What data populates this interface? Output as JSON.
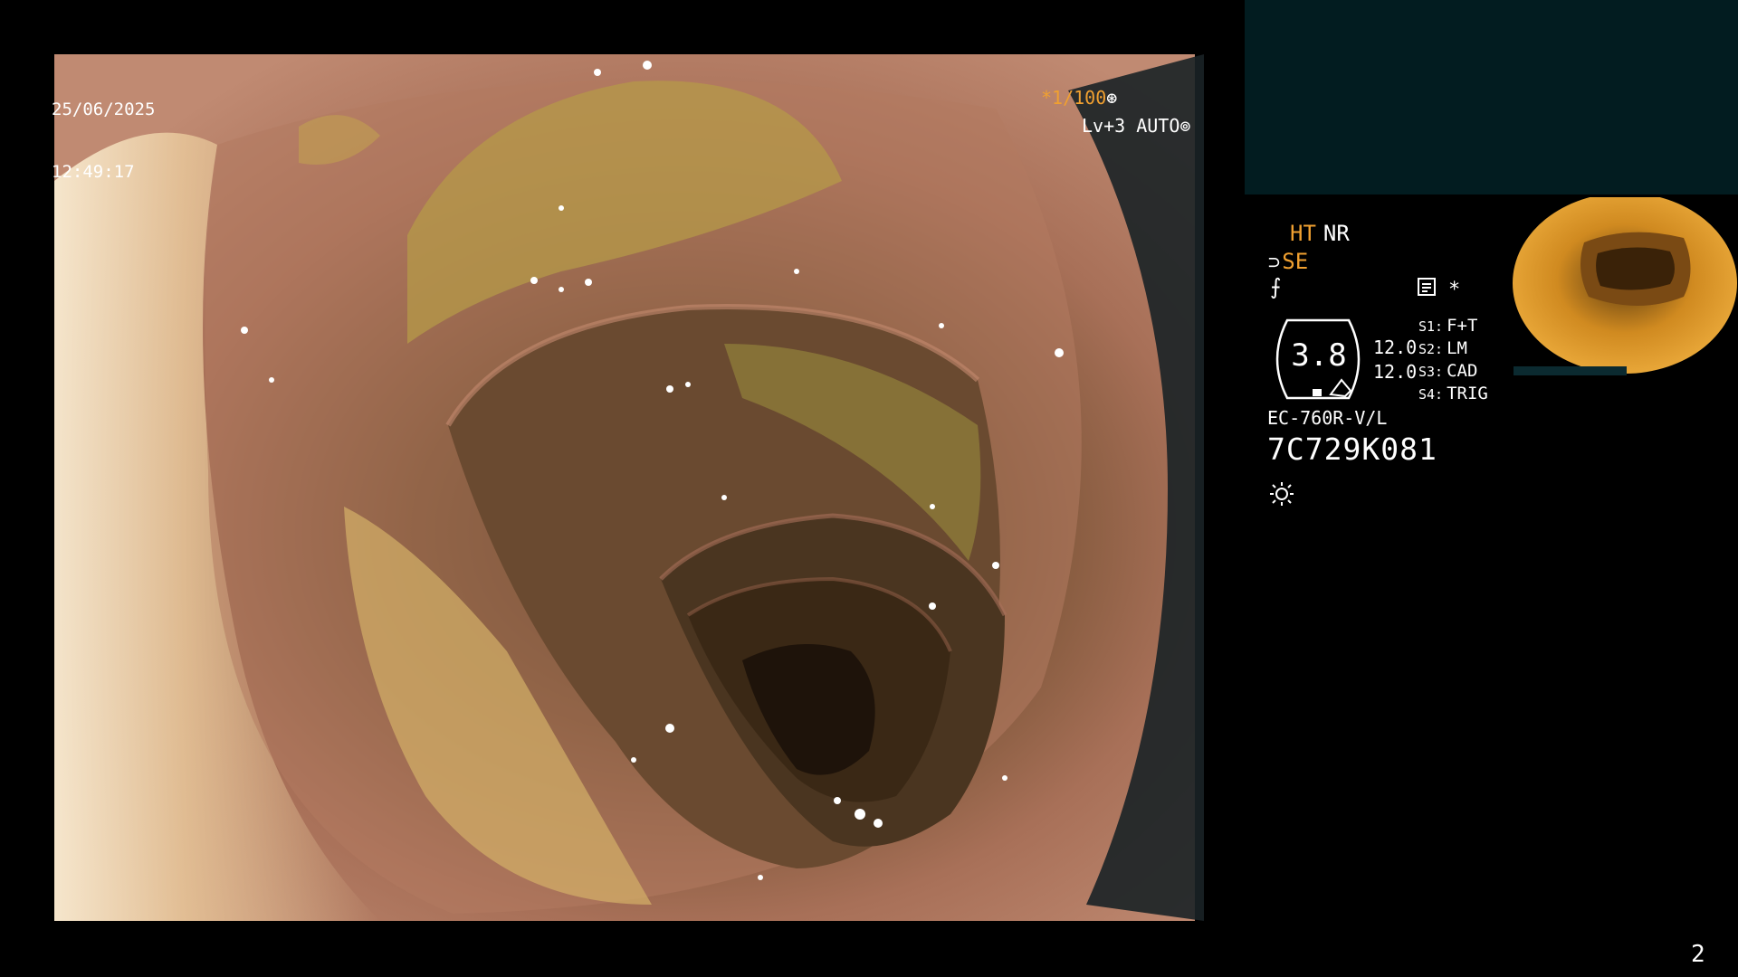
{
  "overlay": {
    "date": "25/06/2025",
    "time": "12:49:17",
    "shutter": "*1/100",
    "shutter_icon": "shutter-icon",
    "iris": "Lv+3 AUTO",
    "iris_icon": "iris-icon"
  },
  "settings": {
    "ht": "HT",
    "nr": "NR",
    "se": "SE",
    "fx_icon": "scissors-icon",
    "memo_icon": "memo-icon",
    "star": "*",
    "zoom": "3.8",
    "value_1": "12.0",
    "value_2": "12.0",
    "switches": [
      {
        "key": "S1:",
        "value": "F+T"
      },
      {
        "key": "S2:",
        "value": "LM"
      },
      {
        "key": "S3:",
        "value": "CAD"
      },
      {
        "key": "S4:",
        "value": "TRIG"
      }
    ]
  },
  "scope": {
    "model": "EC-760R-V/L",
    "serial": "7C729K081",
    "lamp_icon": "light-icon"
  },
  "page_number": "2",
  "colors": {
    "accent": "#f0a030",
    "panel": "#021c20",
    "background": "#000000"
  }
}
